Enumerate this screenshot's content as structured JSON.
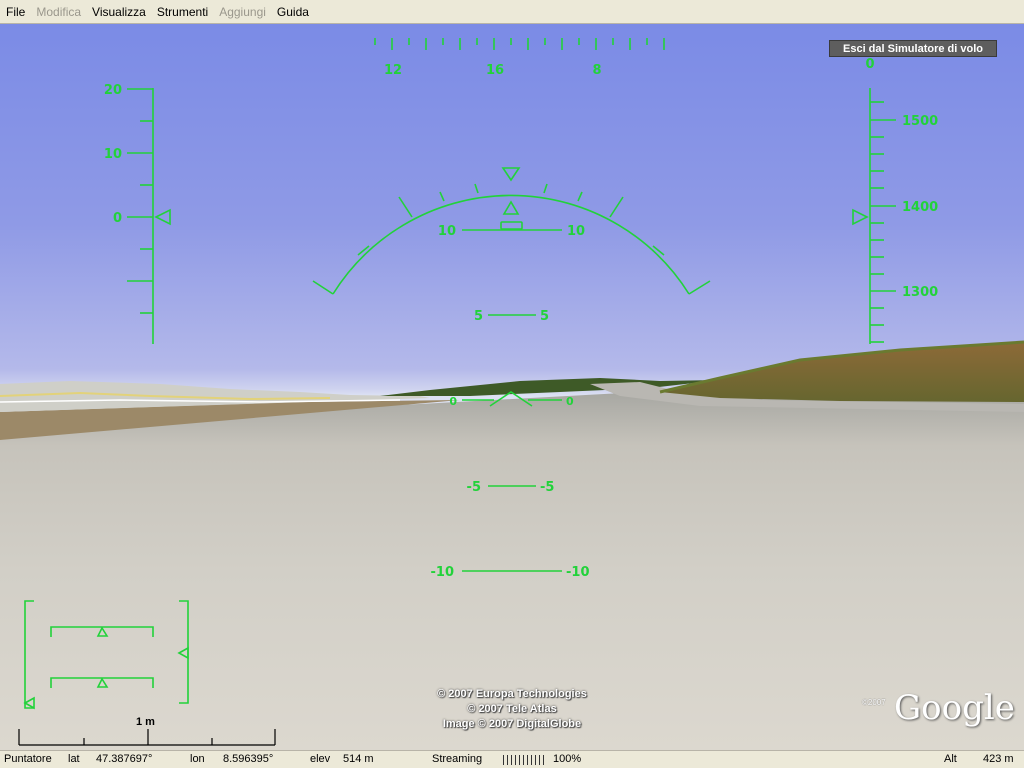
{
  "menu": [
    "File",
    "Modifica",
    "Visualizza",
    "Strumenti",
    "Aggiungi",
    "Guida"
  ],
  "menu_disabled": [
    false,
    true,
    false,
    false,
    true,
    false
  ],
  "exit_button": "Esci dal Simulatore di volo",
  "hud": {
    "heading_labels": [
      "12",
      "16",
      "8"
    ],
    "airspeed": {
      "labels": [
        "20",
        "10",
        "0"
      ],
      "current": "0"
    },
    "altitude": {
      "labels": [
        "1500",
        "1400",
        "1300"
      ],
      "top_readout": "0"
    },
    "pitch_ladder": [
      {
        "left": "10",
        "right": "10"
      },
      {
        "left": "5",
        "right": "5"
      },
      {
        "left": "0",
        "right": "0"
      },
      {
        "left": "-5",
        "right": "-5"
      },
      {
        "left": "-10",
        "right": "-10"
      }
    ]
  },
  "scale_label": "1 m",
  "copyright": [
    "© 2007 Europa Technologies",
    "© 2007 Tele Atlas",
    "Image © 2007 DigitalGlobe"
  ],
  "logo": {
    "text": "Google",
    "year": "©2007"
  },
  "status": {
    "pointer_label": "Puntatore",
    "lat_label": "lat",
    "lat": "47.387697°",
    "lon_label": "lon",
    "lon": "8.596395°",
    "elev_label": "elev",
    "elev": "514 m",
    "streaming_label": "Streaming",
    "streaming_pct": "100%",
    "alt_label": "Alt",
    "alt": "423 m"
  },
  "colors": {
    "hud": "#22d23a",
    "sky_top": "#7b8be6",
    "ground": "#c9c6bf",
    "hill": "#7c5a2c"
  }
}
